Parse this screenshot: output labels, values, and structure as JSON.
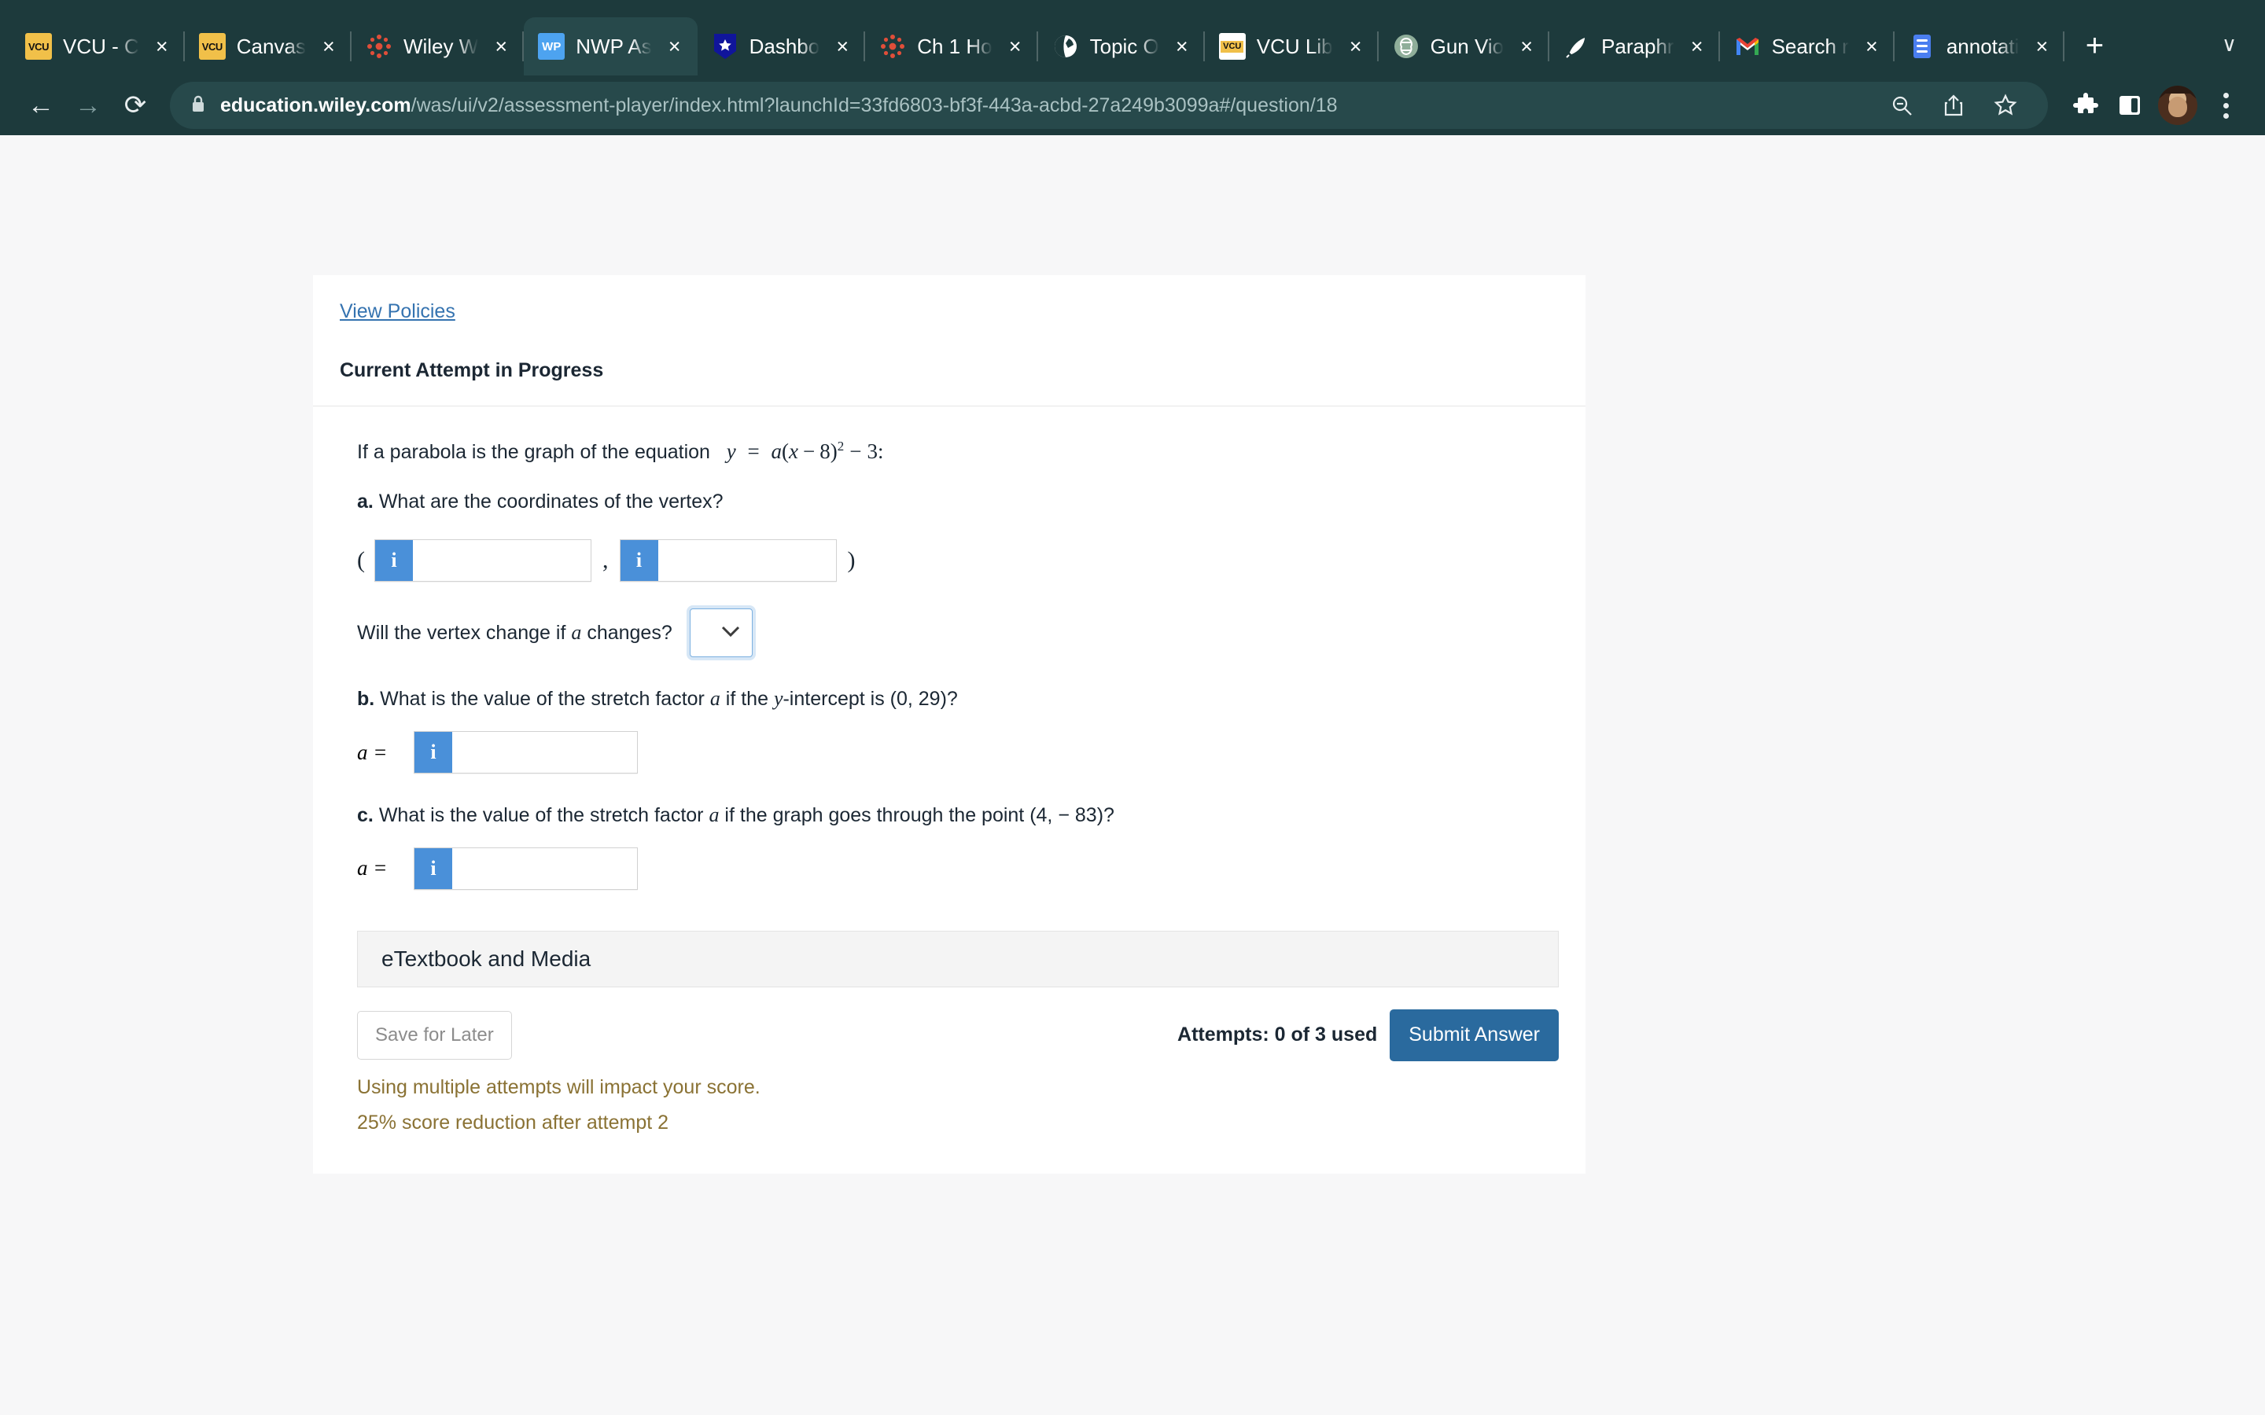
{
  "browser": {
    "tabs": [
      {
        "title": "VCU - C",
        "favicon": "vcu-icon",
        "active": false
      },
      {
        "title": "Canvas",
        "favicon": "vcu-icon",
        "active": false
      },
      {
        "title": "Wiley W",
        "favicon": "canvas-icon",
        "active": false
      },
      {
        "title": "NWP As",
        "favicon": "wiley-plus-icon",
        "active": true
      },
      {
        "title": "Dashbo",
        "favicon": "star-shield-icon",
        "active": false
      },
      {
        "title": "Ch 1 Ho",
        "favicon": "canvas-icon",
        "active": false
      },
      {
        "title": "Topic O",
        "favicon": "globe-icon",
        "active": false
      },
      {
        "title": "VCU Lib",
        "favicon": "vcu-icon",
        "active": false
      },
      {
        "title": "Gun Vio",
        "favicon": "chatgpt-icon",
        "active": false
      },
      {
        "title": "Paraphr",
        "favicon": "quill-icon",
        "active": false
      },
      {
        "title": "Search r",
        "favicon": "gmail-icon",
        "active": false
      },
      {
        "title": "annotati",
        "favicon": "document-icon",
        "active": false
      }
    ],
    "new_tab_label": "+",
    "tab_list_chevron": "∨",
    "close_glyph": "×",
    "nav": {
      "back": "←",
      "forward": "→",
      "reload": "⟳"
    },
    "url": {
      "host": "education.wiley.com",
      "path": "/was/ui/v2/assessment-player/index.html?launchId=33fd6803-bf3f-443a-acbd-27a249b3099a#/question/18"
    },
    "toolbar_icons": [
      "zoom-out-icon",
      "share-icon",
      "bookmark-star-icon",
      "extensions-puzzle-icon",
      "side-panel-icon",
      "profile-avatar",
      "browser-menu-kebab"
    ]
  },
  "page": {
    "view_policies_label": "View Policies",
    "attempt_heading": "Current Attempt in Progress",
    "question": {
      "stem_prefix": "If a parabola is the graph of the equation",
      "equation": "y = a(x − 8)² − 3:",
      "equation_parts": {
        "lhs": "y",
        "eq": "=",
        "a": "a",
        "open": "(",
        "x": "x",
        "minus": "−",
        "eight": "8",
        "close": ")",
        "exp": "2",
        "minus2": "−",
        "three": "3",
        "colon": ":"
      },
      "part_a": {
        "label": "a.",
        "text": "What are the coordinates of the vertex?",
        "open_paren": "(",
        "comma": ",",
        "close_paren": ")",
        "x_value": "",
        "y_value": "",
        "info_glyph": "i"
      },
      "vertex_change": {
        "prompt_before": "Will the vertex change if",
        "prompt_var": "a",
        "prompt_after": "changes?",
        "selected": "",
        "chevron": "⌄"
      },
      "part_b": {
        "label": "b.",
        "text_1": "What is the value of the stretch factor",
        "var": "a",
        "text_2": "if the",
        "var_y": "y",
        "text_3": "-intercept is (0, 29)?",
        "a_equals": "a =",
        "value": "",
        "info_glyph": "i"
      },
      "part_c": {
        "label": "c.",
        "text_1": "What is the value of the stretch factor",
        "var": "a",
        "text_2": "if the graph goes through the point (4,",
        "text_3": "− 83)?",
        "a_equals": "a =",
        "value": "",
        "info_glyph": "i"
      }
    },
    "etextbook_label": "eTextbook and Media",
    "save_for_later_label": "Save for Later",
    "attempts_label": "Attempts: 0 of 3 used",
    "submit_label": "Submit Answer",
    "warning_line_1": "Using multiple attempts will impact your score.",
    "warning_line_2": "25% score reduction after attempt 2"
  },
  "colors": {
    "chrome_bg": "#1d3a3c",
    "active_tab_bg": "#27494b",
    "link_blue": "#3573b0",
    "info_blue": "#4a90d9",
    "submit_blue": "#2a6a9e",
    "warning_brown": "#8a7234",
    "page_bg": "#f7f7f8"
  }
}
